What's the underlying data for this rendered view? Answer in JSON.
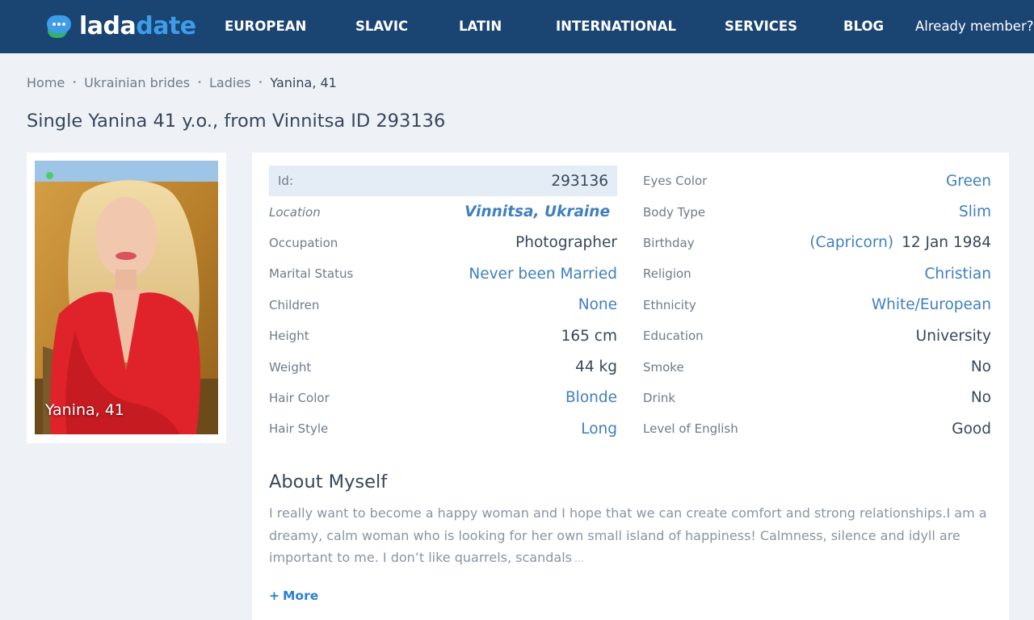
{
  "header": {
    "logo": {
      "part1": "lada",
      "part2": "date"
    },
    "nav": [
      "EUROPEAN",
      "SLAVIC",
      "LATIN",
      "INTERNATIONAL",
      "SERVICES",
      "BLOG"
    ],
    "member_link": "Already member?"
  },
  "breadcrumb": {
    "items": [
      "Home",
      "Ukrainian brides",
      "Ladies"
    ],
    "separator": "•",
    "current": "Yanina, 41"
  },
  "page_title": "Single Yanina 41 y.o., from Vinnitsa ID 293136",
  "photo": {
    "caption": "Yanina, 41",
    "online": true
  },
  "profile": {
    "left": [
      {
        "label": "Id:",
        "value": "293136"
      },
      {
        "label": "Location",
        "value": "Vinnitsa, Ukraine"
      },
      {
        "label": "Occupation",
        "value": "Photographer"
      },
      {
        "label": "Marital Status",
        "value": "Never been Married"
      },
      {
        "label": "Children",
        "value": "None"
      },
      {
        "label": "Height",
        "value": "165 cm"
      },
      {
        "label": "Weight",
        "value": "44 kg"
      },
      {
        "label": "Hair Color",
        "value": "Blonde"
      },
      {
        "label": "Hair Style",
        "value": "Long"
      }
    ],
    "right": [
      {
        "label": "Eyes Color",
        "value": "Green"
      },
      {
        "label": "Body Type",
        "value": "Slim"
      },
      {
        "label": "Birthday",
        "zodiac_open": "(",
        "zodiac": "Capricorn",
        "zodiac_close": ")",
        "value": "12 Jan 1984"
      },
      {
        "label": "Religion",
        "value": "Christian"
      },
      {
        "label": "Ethnicity",
        "value": "White/European"
      },
      {
        "label": "Education",
        "value": "University"
      },
      {
        "label": "Smoke",
        "value": "No"
      },
      {
        "label": "Drink",
        "value": "No"
      },
      {
        "label": "Level of English",
        "value": "Good"
      }
    ]
  },
  "about": {
    "title": "About Myself",
    "text": "I really want to become a happy woman and I hope that we can create comfort and strong relationships.I am a dreamy, calm woman who is looking for her own small island of happiness! Calmness, silence and idyll are important to me. I don’t like quarrels, scandals",
    "ellipsis": "...",
    "more_plus": "+",
    "more_label": "More"
  },
  "colors": {
    "header_bg": "#1a4472",
    "accent_blue": "#3d9de8",
    "link_blue": "#3f7fbf",
    "logo_green": "#31b26b",
    "page_bg": "#eef1f6",
    "id_row_bg": "#e4ecf6"
  }
}
